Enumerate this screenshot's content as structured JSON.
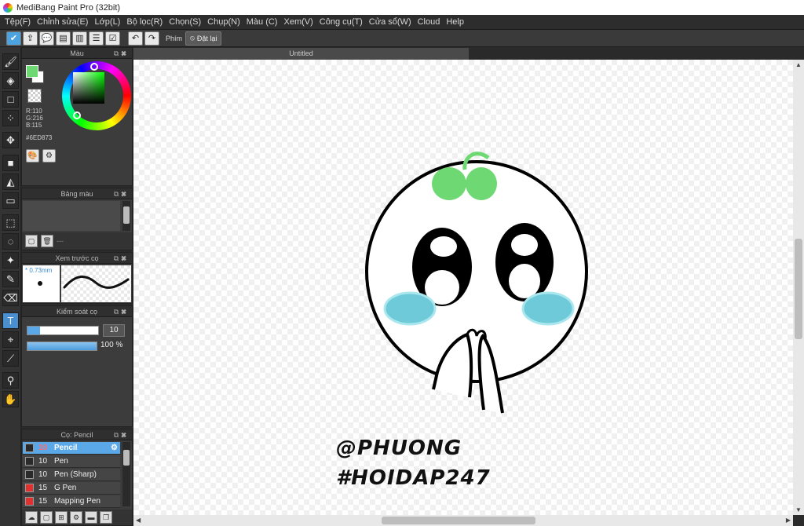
{
  "window": {
    "title": "MediBang Paint Pro (32bit)"
  },
  "menu": [
    "Tệp(F)",
    "Chỉnh sửa(E)",
    "Lớp(L)",
    "Bộ lọc(R)",
    "Chọn(S)",
    "Chụp(N)",
    "Màu (C)",
    "Xem(V)",
    "Công cụ(T)",
    "Cửa sổ(W)",
    "Cloud",
    "Help"
  ],
  "toolbar": {
    "key_label": "Phím",
    "reset_label": "Đặt lại"
  },
  "color_panel": {
    "title": "Màu",
    "r": "R:110",
    "g": "G:216",
    "b": "B:115",
    "hex": "#6ED873",
    "fg_color": "#6ED873",
    "bg_color": "#FFFFFF"
  },
  "palette_panel": {
    "title": "Bảng màu",
    "footer_text": "---"
  },
  "brush_preview": {
    "title": "Xem trước cọ",
    "size": "0.73mm"
  },
  "brush_control": {
    "title": "Kiểm soát cọ",
    "size_value": "10",
    "opacity_value": "100 %",
    "size_fraction": 0.18,
    "opacity_percent": 100
  },
  "brush_list": {
    "title": "Cọ: Pencil",
    "items": [
      {
        "size": "10",
        "name": "Pencil",
        "color": "#2a2a2a",
        "selected": true
      },
      {
        "size": "10",
        "name": "Pen",
        "color": "#2a2a2a",
        "selected": false
      },
      {
        "size": "10",
        "name": "Pen (Sharp)",
        "color": "#2a2a2a",
        "selected": false
      },
      {
        "size": "15",
        "name": "G Pen",
        "color": "#e03030",
        "selected": false
      },
      {
        "size": "15",
        "name": "Mapping Pen",
        "color": "#e03030",
        "selected": false
      }
    ]
  },
  "document": {
    "tab_title": "Untitled"
  },
  "canvas_text": {
    "line1": "@PHUONG",
    "line2": "#HOIDAP247"
  }
}
